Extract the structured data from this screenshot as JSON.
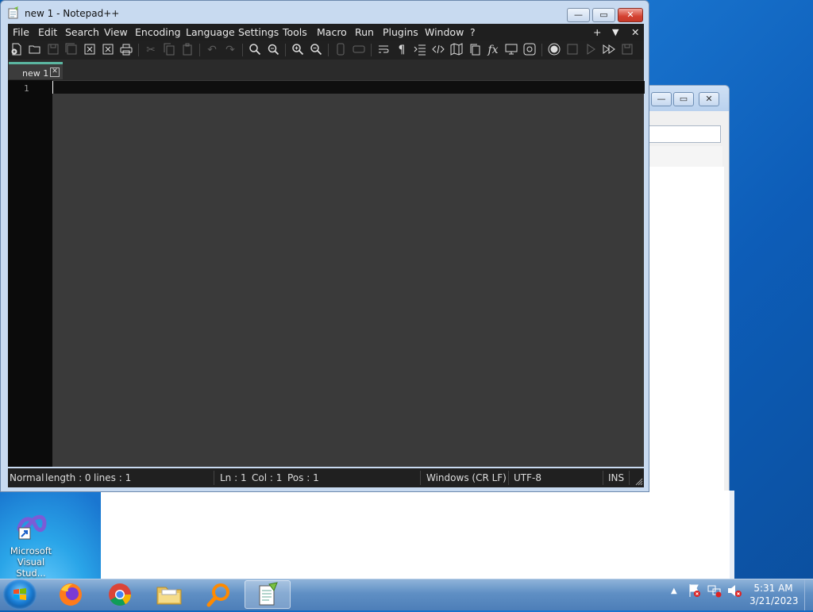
{
  "window": {
    "title": "new 1 - Notepad++",
    "min_glyph": "—",
    "max_glyph": "▭",
    "close_glyph": "✕"
  },
  "menu": {
    "items": [
      "File",
      "Edit",
      "Search",
      "View",
      "Encoding",
      "Language",
      "Settings",
      "Tools",
      "Macro",
      "Run",
      "Plugins",
      "Window",
      "?"
    ],
    "right": {
      "plus": "+",
      "down": "▼",
      "close": "✕"
    }
  },
  "tabs": [
    {
      "label": "new 1",
      "close": "✕"
    }
  ],
  "editor": {
    "line_numbers": [
      "1"
    ]
  },
  "status": {
    "mode": "Normal",
    "length": "length : 0",
    "lines": "lines : 1",
    "ln": "Ln : 1",
    "col": "Col : 1",
    "pos": "Pos : 1",
    "eol": "Windows (CR LF)",
    "encoding": "UTF-8",
    "ins": "INS"
  },
  "desktop": {
    "icon_label_1": "Microsoft",
    "icon_label_2": "Visual Stud..."
  },
  "background_window": {
    "min": "—",
    "max": "▭",
    "close": "✕"
  },
  "clock": {
    "time": "5:31 AM",
    "date": "3/21/2023"
  },
  "colors": {
    "accent_tab": "#5bb6a1",
    "editor_bg": "#3a3a3a",
    "menu_bg": "#1f1f1f"
  }
}
